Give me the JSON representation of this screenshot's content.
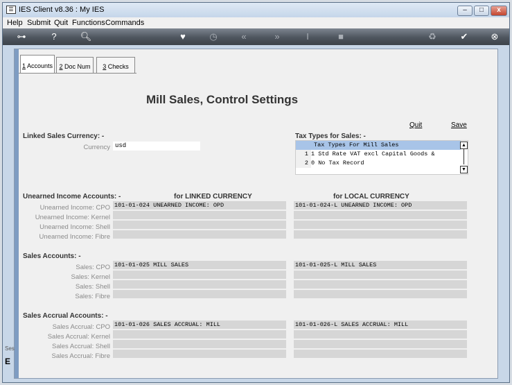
{
  "window": {
    "title": "IES Client v8.36 : My IES",
    "min": "–",
    "max": "□",
    "close": "x"
  },
  "menu": [
    "Help",
    "Submit",
    "Quit",
    "Functions",
    "Commands"
  ],
  "toolbar": {
    "icons": [
      "key-icon",
      "help-icon",
      "search-icon",
      "heart-icon",
      "clock-icon",
      "rewind-icon",
      "forward-icon",
      "text-cursor-icon",
      "square-icon",
      "recycle-icon",
      "check-icon",
      "close-icon"
    ]
  },
  "tabs": [
    {
      "label": "1 Accounts",
      "key": "1",
      "rest": " Accounts"
    },
    {
      "label": "2 Doc Num",
      "key": "2",
      "rest": " Doc Num"
    },
    {
      "label": "3 Checks",
      "key": "3",
      "rest": " Checks"
    }
  ],
  "page_title": "Mill Sales, Control Settings",
  "actions": {
    "quit": "Quit",
    "save": "Save"
  },
  "linked_currency": {
    "heading": "Linked Sales Currency: -",
    "label": "Currency",
    "value": "usd"
  },
  "tax_types": {
    "heading": "Tax Types for Sales: -",
    "list_header": "Tax Types For Mill Sales",
    "rows": [
      {
        "num": "1",
        "text": "1 Std Rate VAT excl Capital Goods &"
      },
      {
        "num": "2",
        "text": "0 No Tax Record"
      }
    ]
  },
  "columns": {
    "linked": "for LINKED CURRENCY",
    "local": "for LOCAL CURRENCY"
  },
  "unearned": {
    "heading": "Unearned Income Accounts: -",
    "labels": [
      "Unearned Income: CPO",
      "Unearned Income: Kernel",
      "Unearned Income: Shell",
      "Unearned Income: Fibre"
    ],
    "linked": [
      "101-01-024 UNEARNED INCOME: OPD",
      "",
      "",
      ""
    ],
    "local": [
      "101-01-024-L UNEARNED INCOME: OPD",
      "",
      "",
      ""
    ]
  },
  "sales": {
    "heading": "Sales Accounts: -",
    "labels": [
      "Sales: CPO",
      "Sales: Kernel",
      "Sales: Shell",
      "Sales: Fibre"
    ],
    "linked": [
      "101-01-025 MILL SALES",
      "",
      "",
      ""
    ],
    "local": [
      "101-01-025-L MILL SALES",
      "",
      "",
      ""
    ]
  },
  "accrual": {
    "heading": "Sales Accrual Accounts: -",
    "labels": [
      "Sales Accrual: CPO",
      "Sales Accrual: Kernel",
      "Sales Accrual: Shell",
      "Sales Accrual: Fibre"
    ],
    "linked": [
      "101-01-026 SALES ACCRUAL: MILL",
      "",
      "",
      ""
    ],
    "local": [
      "101-01-026-L SALES ACCRUAL: MILL",
      "",
      "",
      ""
    ]
  },
  "bottom_fragments": {
    "ses": "Ses",
    "e": "E"
  }
}
